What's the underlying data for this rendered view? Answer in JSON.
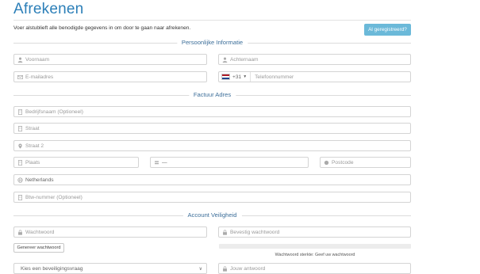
{
  "page": {
    "title": "Afrekenen",
    "intro": "Voer alstublieft alle benodigde gegevens in om door te gaan naar afrekenen.",
    "registered_button": "Al geregistreerd?"
  },
  "sections": {
    "personal": "Persoonlijke Informatie",
    "billing": "Factuur Adres",
    "security": "Account Veiligheid"
  },
  "personal": {
    "first_name": "Voornaam",
    "last_name": "Achternaam",
    "email": "E-mailadres",
    "phone_code": "+31",
    "phone": "Telefoonnummer"
  },
  "billing": {
    "company": "Bedrijfsnaam (Optioneel)",
    "street": "Straat",
    "street2": "Straat 2",
    "city": "Plaats",
    "state": "—",
    "postcode": "Postcode",
    "country": "Netherlands",
    "vat": "Btw-nummer (Optioneel)"
  },
  "security": {
    "password": "Wachtwoord",
    "confirm_password": "Bevestig wachtwoord",
    "generate_button": "Genereer wachtwoord",
    "strength_text": "Wachtwoord sterkte: Geef uw wachtwoord",
    "strength_level": 0,
    "question": "Kies een beveiligingsvraag",
    "answer": "Jouw antwoord"
  },
  "colors": {
    "accent": "#2c7fb8",
    "button": "#6bb9d9",
    "section_label": "#3c6e99"
  }
}
